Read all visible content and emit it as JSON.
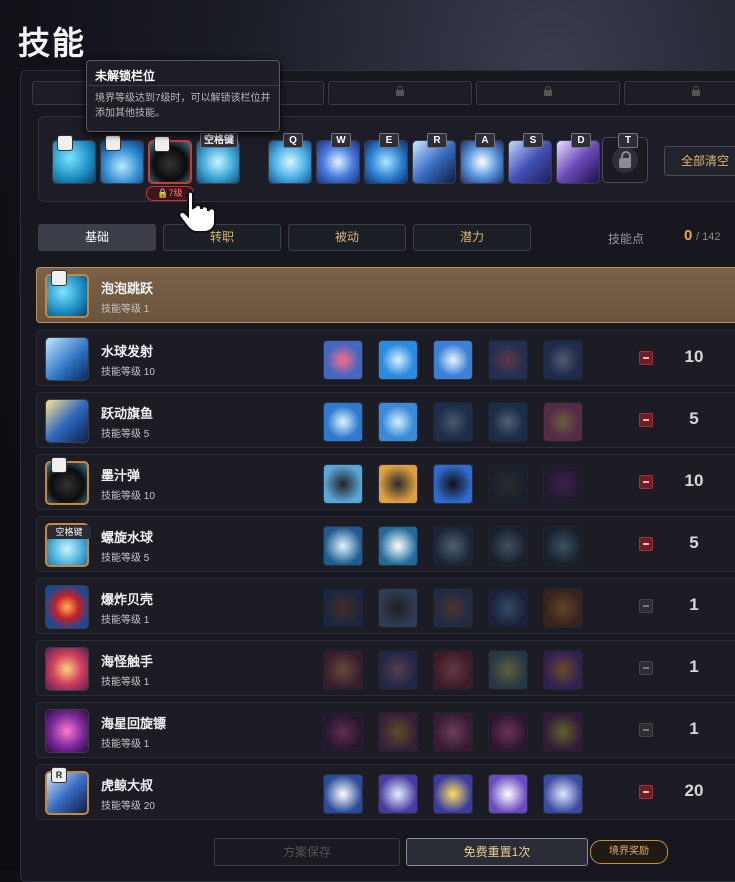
{
  "page": {
    "title": "技能"
  },
  "tooltip": {
    "title": "未解锁栏位",
    "body": "境界等级达到7级时，可以解锁该栏位并添加其他技能。"
  },
  "quickbar": {
    "space_label": "空格键",
    "keys": [
      "Q",
      "W",
      "E",
      "R",
      "A",
      "S",
      "D",
      "T"
    ],
    "clear_all": "全部清空",
    "req_badge": "🔒7级"
  },
  "tabs": [
    "基础",
    "转职",
    "被动",
    "潜力"
  ],
  "skill_points": {
    "label": "技能点",
    "current": "0",
    "total": "/ 142"
  },
  "skills": [
    {
      "name": "泡泡跳跃",
      "level": "技能等级 1",
      "points": ""
    },
    {
      "name": "水球发射",
      "level": "技能等级 10",
      "points": "10"
    },
    {
      "name": "跃动旗鱼",
      "level": "技能等级 5",
      "points": "5"
    },
    {
      "name": "墨汁弹",
      "level": "技能等级 10",
      "points": "10"
    },
    {
      "name": "螺旋水球",
      "level": "技能等级 5",
      "points": "5"
    },
    {
      "name": "爆炸贝壳",
      "level": "技能等级 1",
      "points": "1"
    },
    {
      "name": "海怪触手",
      "level": "技能等级 1",
      "points": "1"
    },
    {
      "name": "海星回旋镖",
      "level": "技能等级 1",
      "points": "1"
    },
    {
      "name": "虎鲸大叔",
      "level": "技能等级 20",
      "points": "20"
    }
  ],
  "footer": {
    "save_preset": "方案保存",
    "free_reset": "免费重置1次",
    "realm_reward": "境界奖励"
  },
  "colors": {
    "accent": "#f0a640",
    "selected_row": "#7a6249",
    "minus_active": "#6b1f24",
    "lock_badge": "#c7343c"
  }
}
